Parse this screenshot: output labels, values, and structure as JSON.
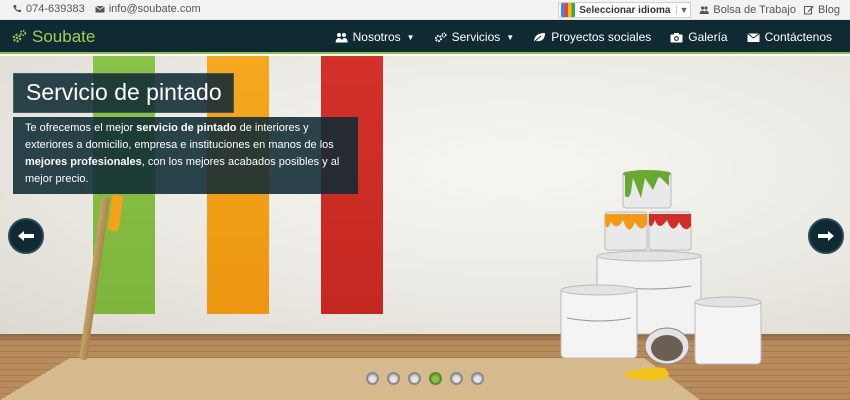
{
  "topbar": {
    "phone": "074-639383",
    "email": "info@soubate.com",
    "language_select": "Seleccionar idioma",
    "links": [
      {
        "label": "Bolsa de Trabajo",
        "icon": "users-icon"
      },
      {
        "label": "Blog",
        "icon": "edit-icon"
      }
    ]
  },
  "brand": {
    "name": "Soubate",
    "icon": "gears-icon",
    "color": "#8bc34a"
  },
  "nav": {
    "items": [
      {
        "label": "Nosotros",
        "icon": "users-icon",
        "has_caret": true
      },
      {
        "label": "Servicios",
        "icon": "gears-icon",
        "has_caret": true
      },
      {
        "label": "Proyectos sociales",
        "icon": "leaf-icon",
        "has_caret": false
      },
      {
        "label": "Galería",
        "icon": "camera-icon",
        "has_caret": false
      },
      {
        "label": "Contáctenos",
        "icon": "envelope-icon",
        "has_caret": false
      }
    ]
  },
  "slide": {
    "title": "Servicio de pintado",
    "text_parts": [
      {
        "t": "Te ofrecemos el mejor ",
        "b": false
      },
      {
        "t": "servicio de pintado",
        "b": true
      },
      {
        "t": " de interiores y exteriores a domicilio, empresa e instituciones en manos de los ",
        "b": false
      },
      {
        "t": "mejores profesionales",
        "b": true
      },
      {
        "t": ", con los mejores acabados posibles y al mejor precio.",
        "b": false
      }
    ],
    "stripe_colors": [
      "#8bc34a",
      "#f2a21b",
      "#cf2f2a"
    ]
  },
  "slider": {
    "total": 6,
    "active_index": 3
  },
  "colors": {
    "navbar": "#0f2a33",
    "accent": "#8bc34a"
  }
}
